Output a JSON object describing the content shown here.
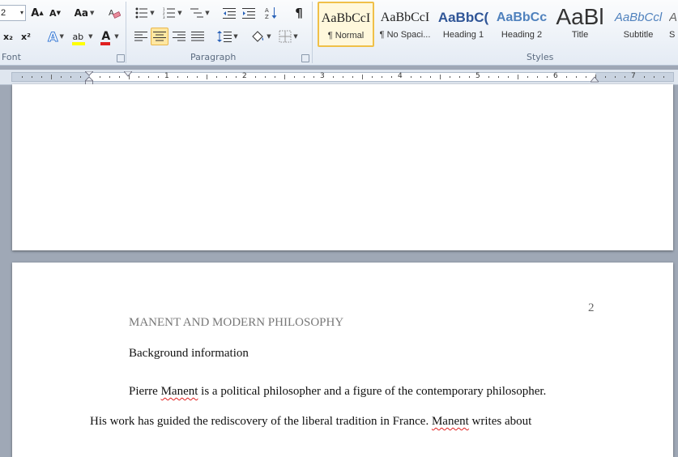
{
  "ribbon": {
    "font_group": {
      "label": "Font",
      "font_size_value": "2",
      "buttons": {
        "grow_font": "A",
        "shrink_font": "A",
        "change_case": "Aa",
        "subscript": "x₂",
        "superscript": "x²",
        "text_effects": "A",
        "highlight": "ab",
        "font_color": "A"
      }
    },
    "paragraph_group": {
      "label": "Paragraph",
      "pilcrow": "¶"
    },
    "styles_group": {
      "label": "Styles",
      "items": [
        {
          "preview": "AaBbCcI",
          "name": "¶ Normal"
        },
        {
          "preview": "AaBbCcI",
          "name": "¶ No Spaci..."
        },
        {
          "preview": "AaBbC(",
          "name": "Heading 1"
        },
        {
          "preview": "AaBbCc",
          "name": "Heading 2"
        },
        {
          "preview": "AaBl",
          "name": "Title"
        },
        {
          "preview": "AaBbCcl",
          "name": "Subtitle"
        },
        {
          "preview": "A",
          "name": "S"
        }
      ]
    }
  },
  "ruler": {
    "numbers": [
      "1",
      "2",
      "3",
      "4",
      "5",
      "6",
      "7"
    ]
  },
  "document": {
    "page_number": "2",
    "running_head": "MANENT AND MODERN PHILOSOPHY",
    "section_heading": "Background information",
    "para1": {
      "t1": "Pierre ",
      "w1": "Manent",
      "t2": " is a political philosopher and a figure of the contemporary philosopher."
    },
    "para2": {
      "t1": "His work has guided the rediscovery of the liberal tradition in France. ",
      "w1": "Manent",
      "t2": " writes about"
    }
  },
  "colors": {
    "accent_selected_style": "#f0c048",
    "active_button": "#ffe7a1",
    "heading_blue": "#2f5597",
    "spelling_error": "#e02020"
  }
}
